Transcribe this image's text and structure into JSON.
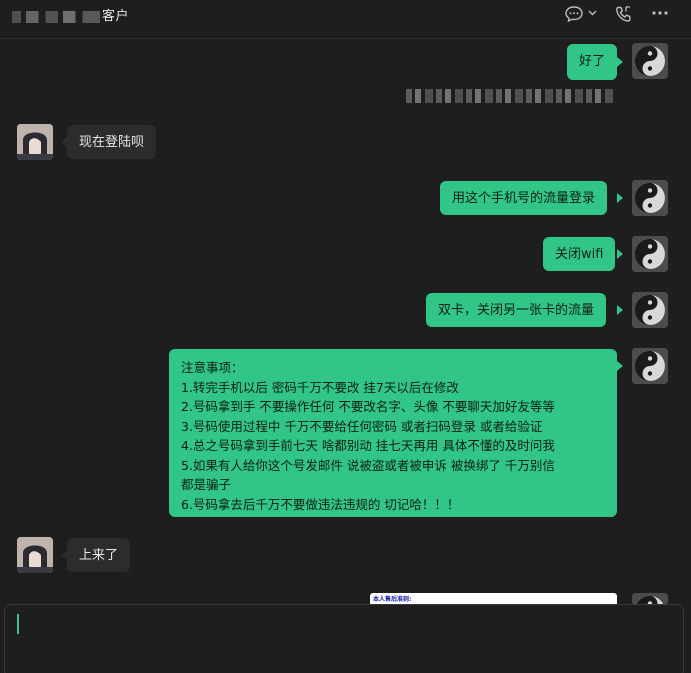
{
  "window": {
    "title": "客户"
  },
  "header": {
    "icons": [
      "chat-bubble-icon",
      "chevron-down-icon",
      "phone-icon",
      "more-icon"
    ]
  },
  "messages": [
    {
      "side": "out",
      "text": "好了"
    },
    {
      "side": "in",
      "text": "现在登陆呗"
    },
    {
      "side": "out",
      "text": "用这个手机号的流量登录"
    },
    {
      "side": "out",
      "text": "关闭wifi"
    },
    {
      "side": "out",
      "text": "双卡，关闭另一张卡的流量"
    },
    {
      "side": "out",
      "lines": [
        "注意事项：",
        "1.转完手机以后 密码千万不要改  挂7天以后在修改",
        "2.号码拿到手 不要操作任何 不要改名字、头像   不要聊天加好友等等",
        "3.号码使用过程中 千万不要给任何密码 或者扫码登录 或者给验证",
        "4.总之号码拿到手前七天 啥都别动 挂七天再用 具体不懂的及时问我",
        "5.如果有人给你这个号发邮件 说被盗或者被申诉 被换绑了 千万别信",
        "都是骗子",
        "6.号码拿去后千万不要做违法违规的 切记哈！！！"
      ]
    },
    {
      "side": "in",
      "text": "上来了"
    },
    {
      "side": "out",
      "image_caption": "本人售后准则:"
    }
  ],
  "colors": {
    "background": "#1e1e1e",
    "outgoing_bubble": "#31c687",
    "incoming_bubble": "#2c2c2c",
    "caret": "#31c687"
  }
}
